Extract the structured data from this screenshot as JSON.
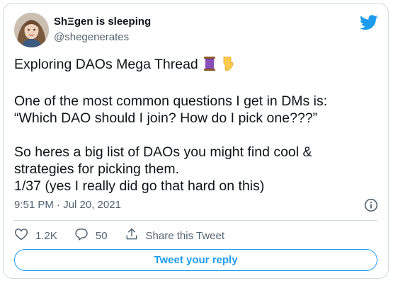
{
  "author": {
    "display_name": "ShΞgen is sleeping",
    "handle": "@shegenerates"
  },
  "tweet": {
    "lines_block1": [
      "Exploring DAOs Mega Thread"
    ],
    "lines_block2": [
      "One of the most common questions I get in DMs is:",
      "“Which DAO should I join? How do I pick one???”"
    ],
    "lines_block3": [
      "So heres a big list of DAOs you might find cool &",
      "strategies for picking them.",
      "1/37 (yes I really did go that hard on this)"
    ],
    "emojis": [
      "spool-of-thread-emoji",
      "pointing-down-emoji"
    ]
  },
  "timestamp": "9:51 PM · Jul 20, 2021",
  "actions": {
    "likes": "1.2K",
    "replies": "50",
    "share_label": "Share this Tweet"
  },
  "reply_button_label": "Tweet your reply",
  "colors": {
    "accent": "#1d9bf0",
    "text": "#0f1419",
    "secondary_text": "#536471",
    "border": "#cfd9de"
  },
  "icons": [
    "twitter-bird-icon",
    "info-icon",
    "heart-icon",
    "reply-icon",
    "share-icon"
  ]
}
